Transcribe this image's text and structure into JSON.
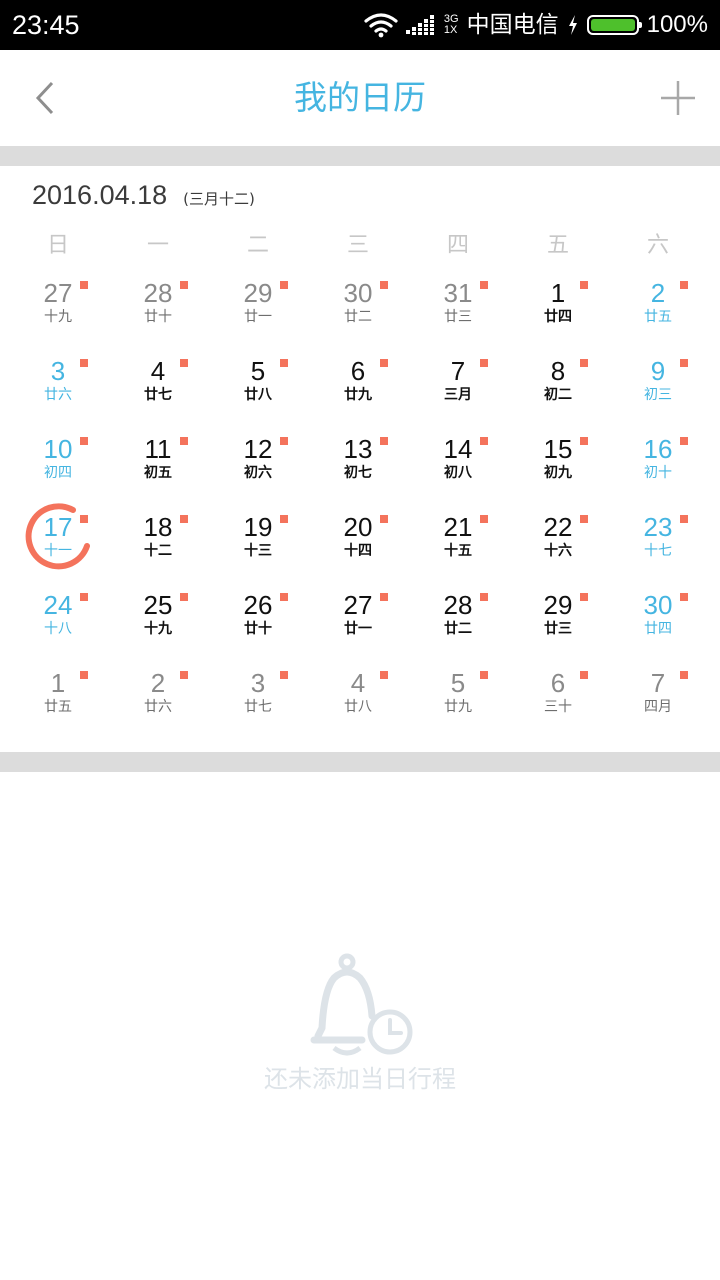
{
  "status_bar": {
    "time": "23:45",
    "network_top": "3G",
    "network_bottom": "1X",
    "carrier": "中国电信",
    "battery_level": 1.0,
    "battery_text": "100%",
    "battery_color": "#4ec02c"
  },
  "header": {
    "title": "我的日历",
    "back_icon": "chevron-left-icon",
    "add_icon": "plus-icon",
    "accent_color": "#45b5e1"
  },
  "calendar": {
    "date": "2016.04.18",
    "lunar_date": "(三月十二)",
    "weekdays": [
      "日",
      "一",
      "二",
      "三",
      "四",
      "五",
      "六"
    ],
    "today_color": "#f4735c",
    "weeks": [
      [
        {
          "day": "27",
          "lunar": "十九",
          "kind": "other"
        },
        {
          "day": "28",
          "lunar": "廿十",
          "kind": "other"
        },
        {
          "day": "29",
          "lunar": "廿一",
          "kind": "other"
        },
        {
          "day": "30",
          "lunar": "廿二",
          "kind": "other"
        },
        {
          "day": "31",
          "lunar": "廿三",
          "kind": "other"
        },
        {
          "day": "1",
          "lunar": "廿四",
          "kind": "normal"
        },
        {
          "day": "2",
          "lunar": "廿五",
          "kind": "weekend"
        }
      ],
      [
        {
          "day": "3",
          "lunar": "廿六",
          "kind": "weekend"
        },
        {
          "day": "4",
          "lunar": "廿七",
          "kind": "normal"
        },
        {
          "day": "5",
          "lunar": "廿八",
          "kind": "normal"
        },
        {
          "day": "6",
          "lunar": "廿九",
          "kind": "normal"
        },
        {
          "day": "7",
          "lunar": "三月",
          "kind": "normal"
        },
        {
          "day": "8",
          "lunar": "初二",
          "kind": "normal"
        },
        {
          "day": "9",
          "lunar": "初三",
          "kind": "weekend"
        }
      ],
      [
        {
          "day": "10",
          "lunar": "初四",
          "kind": "weekend"
        },
        {
          "day": "11",
          "lunar": "初五",
          "kind": "normal"
        },
        {
          "day": "12",
          "lunar": "初六",
          "kind": "normal"
        },
        {
          "day": "13",
          "lunar": "初七",
          "kind": "normal"
        },
        {
          "day": "14",
          "lunar": "初八",
          "kind": "normal"
        },
        {
          "day": "15",
          "lunar": "初九",
          "kind": "normal"
        },
        {
          "day": "16",
          "lunar": "初十",
          "kind": "weekend"
        }
      ],
      [
        {
          "day": "17",
          "lunar": "十一",
          "kind": "weekend"
        },
        {
          "day": "18",
          "lunar": "十二",
          "kind": "today"
        },
        {
          "day": "19",
          "lunar": "十三",
          "kind": "normal"
        },
        {
          "day": "20",
          "lunar": "十四",
          "kind": "normal"
        },
        {
          "day": "21",
          "lunar": "十五",
          "kind": "normal"
        },
        {
          "day": "22",
          "lunar": "十六",
          "kind": "normal"
        },
        {
          "day": "23",
          "lunar": "十七",
          "kind": "weekend"
        }
      ],
      [
        {
          "day": "24",
          "lunar": "十八",
          "kind": "weekend"
        },
        {
          "day": "25",
          "lunar": "十九",
          "kind": "normal"
        },
        {
          "day": "26",
          "lunar": "廿十",
          "kind": "normal"
        },
        {
          "day": "27",
          "lunar": "廿一",
          "kind": "normal"
        },
        {
          "day": "28",
          "lunar": "廿二",
          "kind": "normal"
        },
        {
          "day": "29",
          "lunar": "廿三",
          "kind": "normal"
        },
        {
          "day": "30",
          "lunar": "廿四",
          "kind": "weekend"
        }
      ],
      [
        {
          "day": "1",
          "lunar": "廿五",
          "kind": "other"
        },
        {
          "day": "2",
          "lunar": "廿六",
          "kind": "other"
        },
        {
          "day": "3",
          "lunar": "廿七",
          "kind": "other"
        },
        {
          "day": "4",
          "lunar": "廿八",
          "kind": "other"
        },
        {
          "day": "5",
          "lunar": "廿九",
          "kind": "other"
        },
        {
          "day": "6",
          "lunar": "三十",
          "kind": "other"
        },
        {
          "day": "7",
          "lunar": "四月",
          "kind": "other"
        }
      ]
    ]
  },
  "empty_state": {
    "icon": "bell-clock-icon",
    "text": "还未添加当日行程"
  }
}
